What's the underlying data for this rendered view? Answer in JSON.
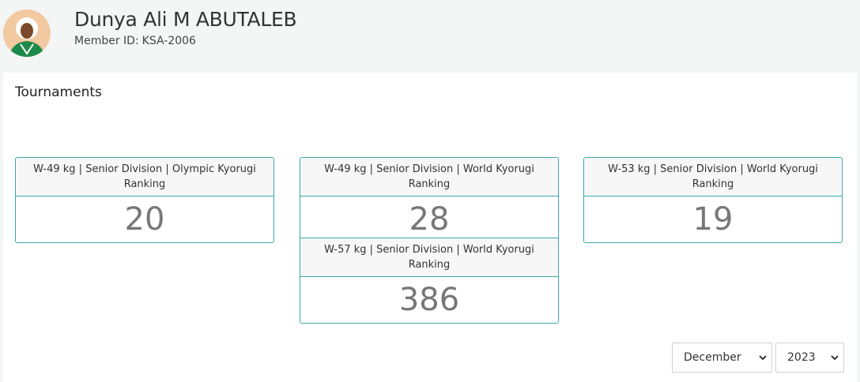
{
  "athlete": {
    "name": "Dunya Ali M ABUTALEB",
    "member_label": "Member ID:",
    "member_id": "KSA-2006"
  },
  "section": {
    "title": "Tournaments"
  },
  "rankings": [
    {
      "label": "W-49 kg | Senior Division | Olympic Kyorugi Ranking",
      "rank": "20"
    },
    {
      "label": "W-49 kg | Senior Division | World Kyorugi Ranking",
      "rank": "28"
    },
    {
      "label": "W-53 kg | Senior Division | World Kyorugi Ranking",
      "rank": "19"
    },
    {
      "label": "W-57 kg | Senior Division | World Kyorugi Ranking",
      "rank": "386"
    }
  ],
  "filters": {
    "month": "December",
    "year": "2023"
  },
  "colors": {
    "accent": "#3aaba5",
    "rank_text": "#777777"
  },
  "icons": {
    "avatar": "athlete-photo",
    "dropdown": "chevron-down-icon"
  }
}
